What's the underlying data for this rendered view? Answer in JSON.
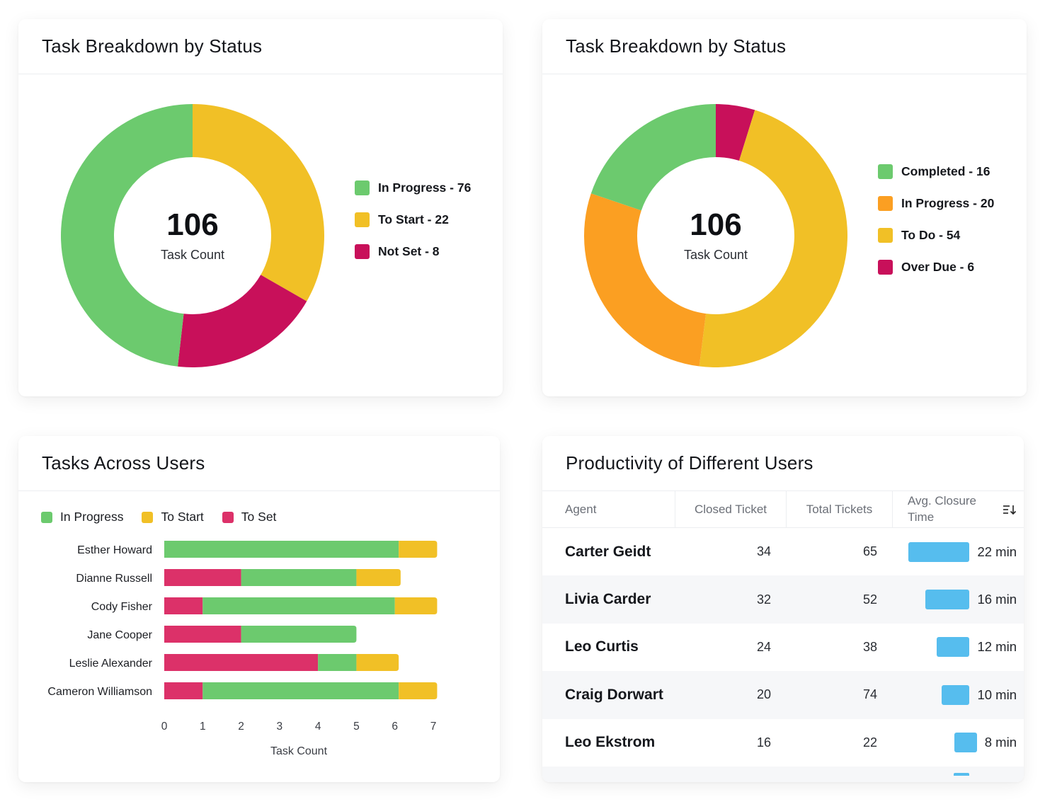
{
  "panels": {
    "status_a": {
      "title": "Task Breakdown by Status",
      "center_value": "106",
      "center_label": "Task Count"
    },
    "status_b": {
      "title": "Task Breakdown by Status",
      "center_value": "106",
      "center_label": "Task Count"
    },
    "users": {
      "title": "Tasks Across Users"
    },
    "productivity": {
      "title": "Productivity of Different Users",
      "columns": [
        "Agent",
        "Closed Ticket",
        "Total Tickets",
        "Avg. Closure Time"
      ],
      "sort_icon": "sort-descending-icon",
      "rows": [
        {
          "agent": "Carter Geidt",
          "closed": "34",
          "total": "65",
          "avg_minutes": 22,
          "avg_label": "22 min"
        },
        {
          "agent": "Livia Carder",
          "closed": "32",
          "total": "52",
          "avg_minutes": 16,
          "avg_label": "16 min"
        },
        {
          "agent": "Leo Curtis",
          "closed": "24",
          "total": "38",
          "avg_minutes": 12,
          "avg_label": "12 min"
        },
        {
          "agent": "Craig Dorwart",
          "closed": "20",
          "total": "74",
          "avg_minutes": 10,
          "avg_label": "10 min"
        },
        {
          "agent": "Leo Ekstrom",
          "closed": "16",
          "total": "22",
          "avg_minutes": 8,
          "avg_label": "8 min"
        }
      ],
      "bar_color": "#56bdee"
    }
  },
  "chart_data": [
    {
      "type": "pie",
      "variant": "donut",
      "title": "Task Breakdown by Status",
      "center_value": 106,
      "center_label": "Task Count",
      "legend_position": "right",
      "slices": [
        {
          "label": "In Progress",
          "value": 76,
          "legend": "In Progress - 76",
          "color": "#6cca6e"
        },
        {
          "label": "To Start",
          "value": 22,
          "legend": "To Start - 22",
          "color": "#f1c026"
        },
        {
          "label": "Not Set",
          "value": 8,
          "legend": "Not Set - 8",
          "color": "#c8105a"
        }
      ],
      "drawn_order": [
        "To Start",
        "Not Set",
        "In Progress"
      ],
      "drawn_fractions": [
        0.333,
        0.185,
        0.482
      ]
    },
    {
      "type": "pie",
      "variant": "donut",
      "title": "Task Breakdown by Status",
      "center_value": 106,
      "center_label": "Task Count",
      "legend_position": "right",
      "slices": [
        {
          "label": "Completed",
          "value": 16,
          "legend": "Completed - 16",
          "color": "#6cca6e"
        },
        {
          "label": "In Progress",
          "value": 20,
          "legend": "In Progress - 20",
          "color": "#fb9f22"
        },
        {
          "label": "To Do",
          "value": 54,
          "legend": "To Do - 54",
          "color": "#f1c026"
        },
        {
          "label": "Over Due",
          "value": 6,
          "legend": "Over Due - 6",
          "color": "#c8105a"
        }
      ],
      "drawn_order": [
        "Over Due",
        "To Do",
        "In Progress",
        "Completed"
      ],
      "drawn_fractions": [
        0.048,
        0.472,
        0.282,
        0.198
      ]
    },
    {
      "type": "bar",
      "orientation": "horizontal",
      "stacked": true,
      "title": "Tasks Across Users",
      "xlabel": "Task Count",
      "ylabel": "",
      "xlim": [
        0,
        7
      ],
      "xticks": [
        "0",
        "1",
        "2",
        "3",
        "4",
        "5",
        "6",
        "7"
      ],
      "grid": false,
      "legend_position": "top-left",
      "categories": [
        "Esther Howard",
        "Dianne Russell",
        "Cody Fisher",
        "Jane Cooper",
        "Leslie Alexander",
        "Cameron Williamson"
      ],
      "legend": [
        {
          "name": "In Progress",
          "color": "#6cca6e"
        },
        {
          "name": "To Start",
          "color": "#f1c026"
        },
        {
          "name": "To Set",
          "color": "#dc3169"
        }
      ],
      "stack_order": [
        "To Set",
        "In Progress",
        "To Start"
      ],
      "series": [
        {
          "name": "To Set",
          "color": "#dc3169",
          "values": [
            0,
            2,
            1,
            2,
            4,
            1
          ]
        },
        {
          "name": "In Progress",
          "color": "#6cca6e",
          "values": [
            6.1,
            3,
            5,
            3,
            1,
            5.1
          ]
        },
        {
          "name": "To Start",
          "color": "#f1c026",
          "values": [
            1,
            1.15,
            1.1,
            0,
            1.1,
            1
          ]
        }
      ]
    }
  ]
}
